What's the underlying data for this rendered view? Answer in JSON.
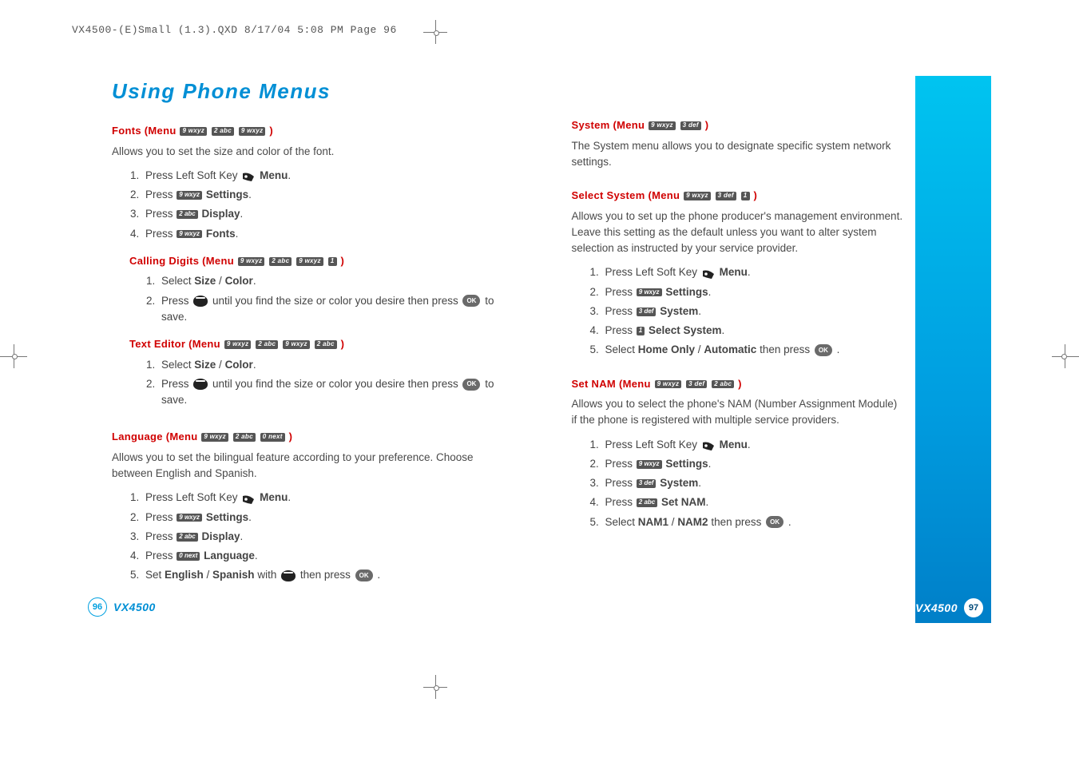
{
  "meta": {
    "slug": "VX4500-(E)Small (1.3).QXD  8/17/04  5:08 PM  Page 96"
  },
  "title": "Using Phone Menus",
  "model": "VX4500",
  "page_left": "96",
  "page_right": "97",
  "keys": {
    "k9": "9 wxyz",
    "k2": "2 abc",
    "k0": "0 next",
    "k1": "1",
    "k3": "3 def",
    "ok": "OK"
  },
  "labels": {
    "press": "Press ",
    "press_left_soft": "Press Left Soft Key ",
    "menu": "Menu",
    "settings": "Settings",
    "display": "Display",
    "fonts": "Fonts",
    "language": "Language",
    "system": "System",
    "select_system": "Select System",
    "set_nam": "Set NAM",
    "select": "Select ",
    "size": "Size",
    "color": "Color",
    "until_find": " until you find the size or color you desire then press ",
    "to_save": " to save.",
    "set": "Set ",
    "english": "English",
    "spanish": "Spanish",
    "with": " with ",
    "then_press": " then press ",
    "home_only": "Home Only",
    "automatic": "Automatic",
    "nam1": "NAM1",
    "nam2": "NAM2",
    "slash": " / ",
    "dot": "."
  },
  "sections": {
    "fonts": {
      "head_a": "Fonts (Menu ",
      "head_b": " )",
      "desc": "Allows you to set the size and color of the font."
    },
    "calling_digits": {
      "head_a": "Calling Digits (Menu ",
      "head_b": " )"
    },
    "text_editor": {
      "head_a": "Text Editor (Menu ",
      "head_b": " )"
    },
    "language_sec": {
      "head_a": "Language (Menu ",
      "head_b": " )",
      "desc": "Allows you to set the bilingual feature according to your preference. Choose between English and Spanish."
    },
    "system_sec": {
      "head_a": "System (Menu ",
      "head_b": " )",
      "desc": "The System menu allows you to designate specific system network settings."
    },
    "select_system_sec": {
      "head_a": "Select System (Menu ",
      "head_b": " )",
      "desc": "Allows you to set up the phone producer's management environment. Leave this setting as the default unless you want to alter system selection as instructed by your service provider."
    },
    "set_nam_sec": {
      "head_a": "Set NAM (Menu ",
      "head_b": " )",
      "desc": "Allows you to select the phone's NAM (Number Assignment Module) if the phone is registered with multiple service providers."
    }
  }
}
